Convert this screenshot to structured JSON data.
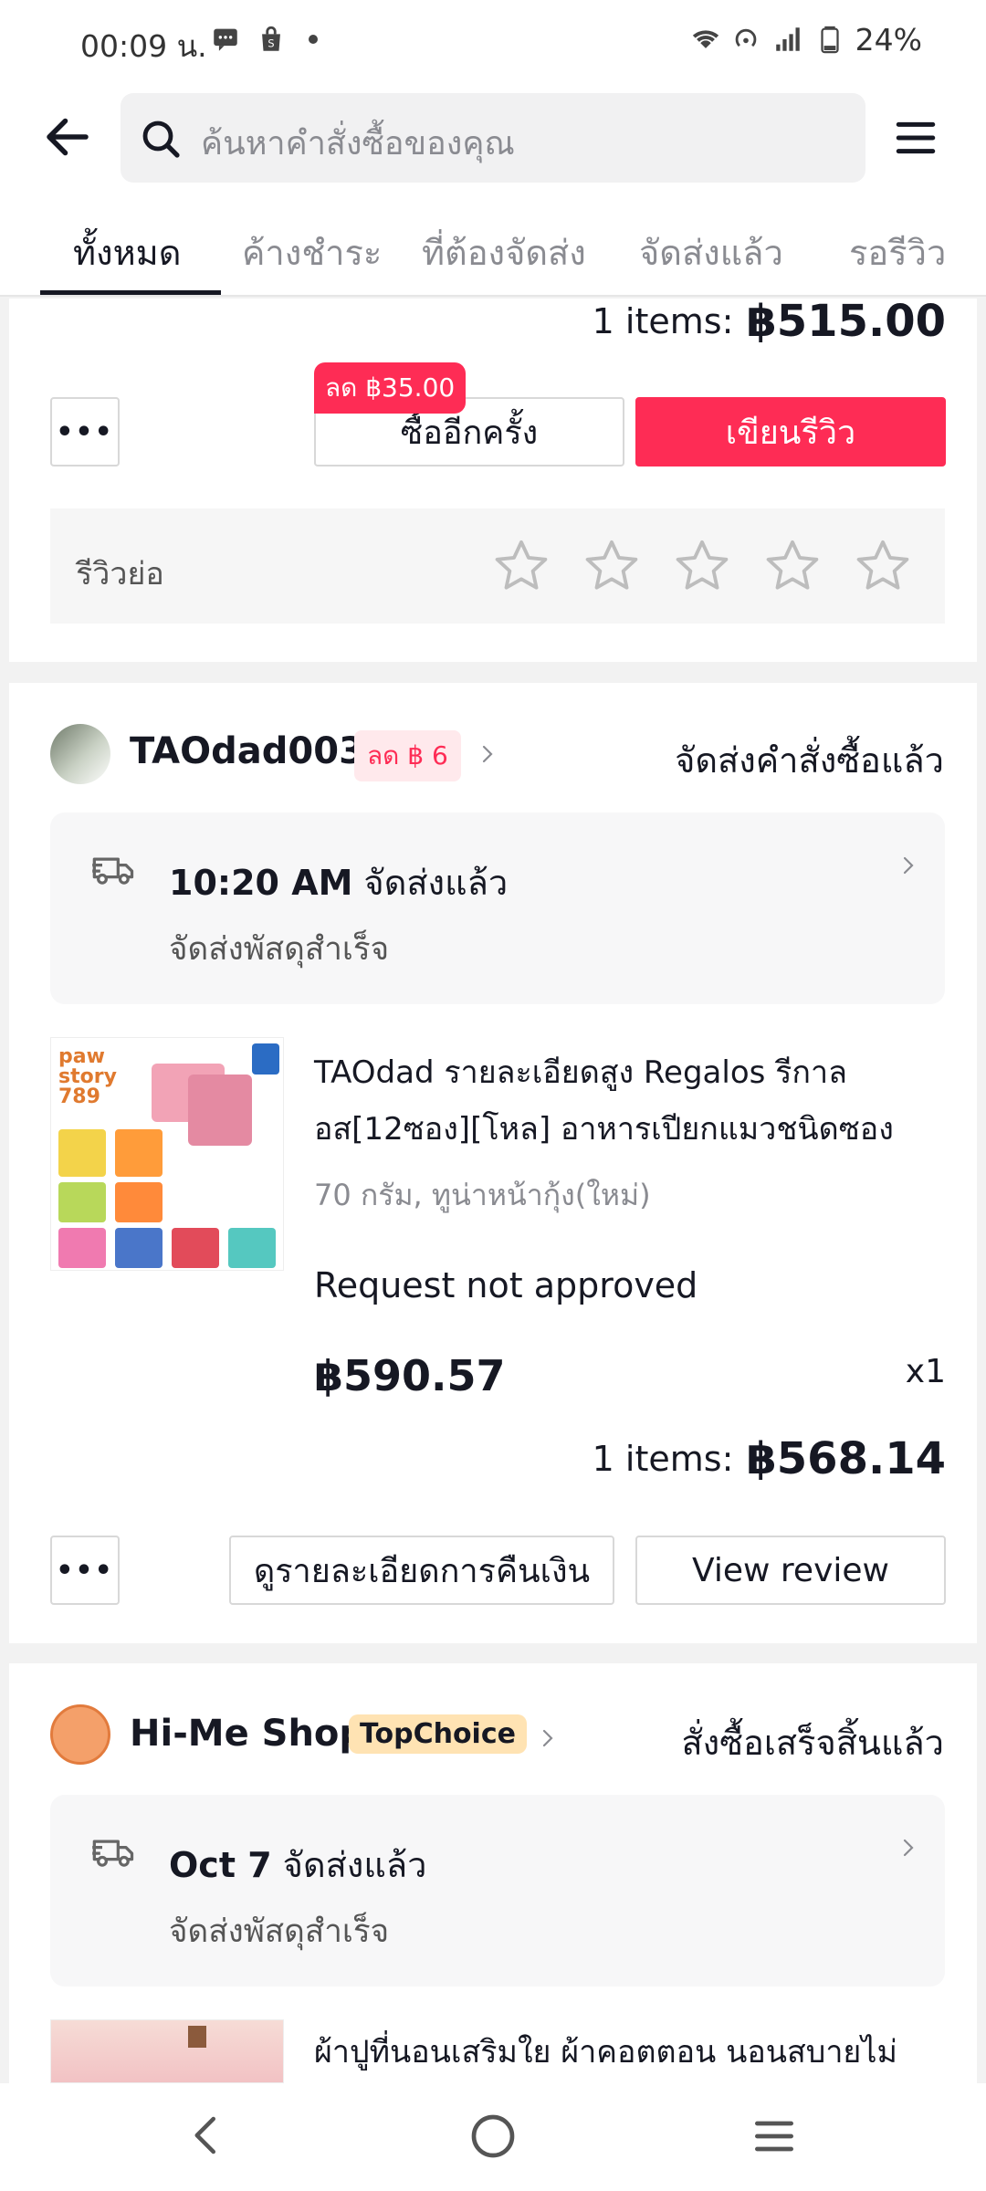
{
  "status_bar": {
    "time": "00:09 น.",
    "battery": "24%"
  },
  "header": {
    "search_placeholder": "ค้นหาคำสั่งซื้อของคุณ"
  },
  "tabs": [
    "ทั้งหมด",
    "ค้างชำระ",
    "ที่ต้องจัดส่ง",
    "จัดส่งแล้ว",
    "รอรีวิว"
  ],
  "order1": {
    "items_label": "1 items:",
    "total": "฿515.00",
    "promo": "ลด ฿35.00",
    "buy_again": "ซื้ออีกครั้ง",
    "write_review": "เขียนรีวิว",
    "quick_review_label": "รีวิวย่อ"
  },
  "order2": {
    "shop_name": "TAOdad003",
    "discount_badge": "ลด ฿ 6",
    "status": "จัดส่งคำสั่งซื้อแล้ว",
    "delivery_time": "10:20 AM",
    "delivery_status": "จัดส่งแล้ว",
    "delivery_sub": "จัดส่งพัสดุสำเร็จ",
    "product_title_line1": "TAOdad รายละเอียดสูง  Regalos รีกาล",
    "product_title_line2": "อส[12ซอง][โหล] อาหารเปียกแมวชนิดซอง",
    "product_variant": "70 กรัม, ทูน่าหน้ากุ้ง(ใหม่)",
    "request_status": "Request not approved",
    "price": "฿590.57",
    "quantity": "x1",
    "items_label": "1 items:",
    "total": "฿568.14",
    "refund_details": "ดูรายละเอียดการคืนเงิน",
    "view_review": "View review",
    "product_image_text": "paw story 789"
  },
  "order3": {
    "shop_name": "Hi-Me Shop",
    "badge": "TopChoice",
    "status": "สั่งซื้อเสร็จสิ้นแล้ว",
    "delivery_time": "Oct 7",
    "delivery_status": "จัดส่งแล้ว",
    "delivery_sub": "จัดส่งพัสดุสำเร็จ",
    "product_title_line1": "ผ้าปูที่นอนเสริมใย ผ้าคอตตอน นอนสบายไม่"
  },
  "colors": {
    "accent": "#fe2c55",
    "text": "#161823",
    "muted": "#8a8b91"
  },
  "icons": [
    "back-arrow-icon",
    "search-icon",
    "menu-icon",
    "star-icon",
    "truck-icon",
    "chevron-right-icon",
    "nav-back-icon",
    "nav-home-icon",
    "nav-recents-icon"
  ]
}
